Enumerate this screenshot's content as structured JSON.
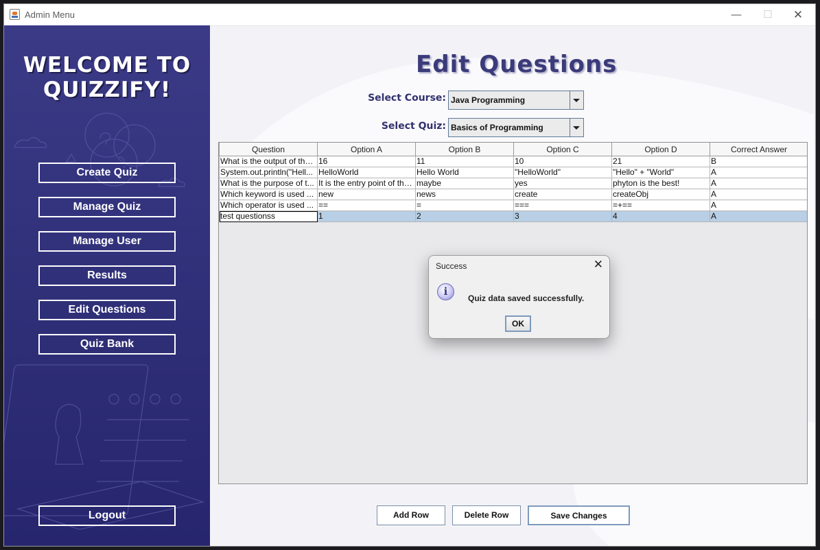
{
  "window": {
    "title": "Admin Menu"
  },
  "sidebar": {
    "welcome_line1": "WELCOME TO",
    "welcome_line2": "QUIZZIFY!",
    "items": [
      {
        "label": "Create Quiz"
      },
      {
        "label": "Manage Quiz"
      },
      {
        "label": "Manage User"
      },
      {
        "label": "Results"
      },
      {
        "label": "Edit Questions"
      },
      {
        "label": "Quiz Bank"
      }
    ],
    "logout_label": "Logout"
  },
  "main": {
    "title": "Edit Questions",
    "course_label": "Select Course:",
    "course_value": "Java Programming",
    "quiz_label": "Select Quiz:",
    "quiz_value": "Basics of Programming"
  },
  "table": {
    "headers": [
      "Question",
      "Option A",
      "Option B",
      "Option C",
      "Option D",
      "Correct Answer"
    ],
    "rows": [
      [
        "What is the output of the...",
        "16",
        "11",
        "10",
        "21",
        "B"
      ],
      [
        "System.out.println(\"Hell...",
        "HelloWorld",
        "Hello World",
        "\"HelloWorld\"",
        "\"Hello\" + \"World\"",
        "A"
      ],
      [
        "What is the purpose of t...",
        "It is the entry point of the...",
        "maybe",
        "yes",
        "phyton is the best!",
        "A"
      ],
      [
        "Which keyword is used ...",
        "new",
        "news",
        "create",
        "createObj",
        "A"
      ],
      [
        "Which operator is used ...",
        "==",
        "=",
        "===",
        "=+==",
        "A"
      ],
      [
        "test questionss",
        "1",
        "2",
        "3",
        "4",
        "A"
      ]
    ]
  },
  "buttons": {
    "add_row": "Add Row",
    "delete_row": "Delete Row",
    "save_changes": "Save Changes"
  },
  "dialog": {
    "title": "Success",
    "message": "Quiz data saved successfully.",
    "ok_label": "OK",
    "icon": "info-icon"
  }
}
